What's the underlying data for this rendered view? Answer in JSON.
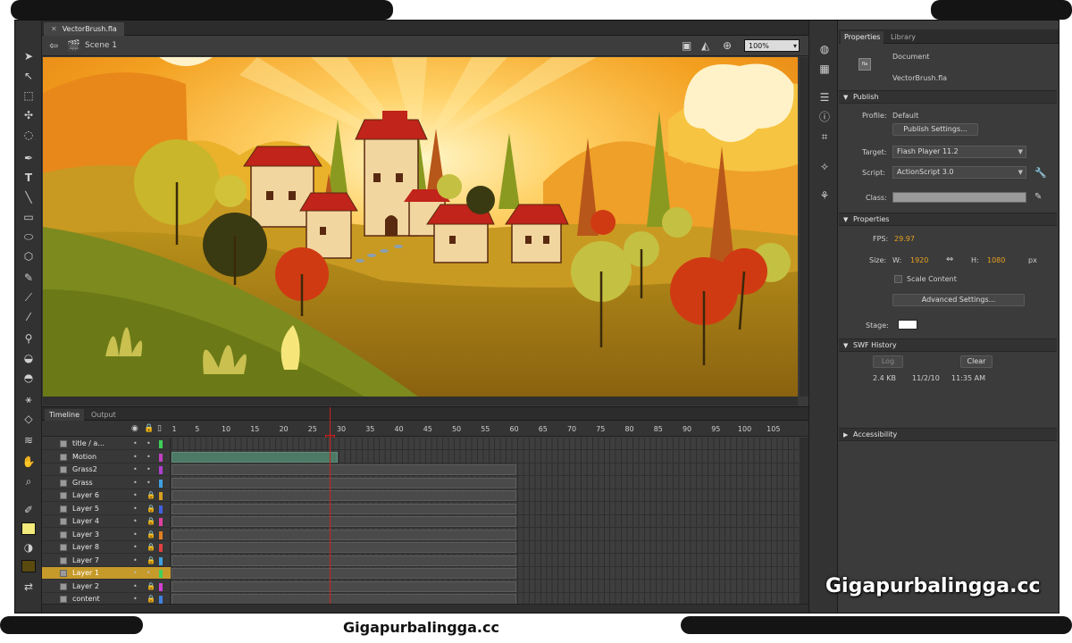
{
  "document": {
    "tab_title": "VectorBrush.fla",
    "scene_label": "Scene 1",
    "zoom": "100%"
  },
  "timeline": {
    "tabs": [
      "Timeline",
      "Output"
    ],
    "frame_labels": [
      "1",
      "5",
      "10",
      "15",
      "20",
      "25",
      "30",
      "35",
      "40",
      "45",
      "50",
      "55",
      "60",
      "65",
      "70",
      "75",
      "80",
      "85",
      "90",
      "95",
      "100",
      "105"
    ],
    "current_frame": 28,
    "layers": [
      {
        "name": "title / a...",
        "type": "folder",
        "color": "#3fd05a"
      },
      {
        "name": "Motion",
        "color": "#c040c0"
      },
      {
        "name": "Grass2",
        "color": "#b040d0"
      },
      {
        "name": "Grass",
        "color": "#40a0e0"
      },
      {
        "name": "Layer 6",
        "color": "#d8a020",
        "locked": true
      },
      {
        "name": "Layer 5",
        "color": "#4060e0",
        "locked": true
      },
      {
        "name": "Layer 4",
        "color": "#e040a0",
        "locked": true
      },
      {
        "name": "Layer 3",
        "color": "#e08020",
        "locked": true
      },
      {
        "name": "Layer 8",
        "color": "#e04040",
        "locked": true
      },
      {
        "name": "Layer 7",
        "color": "#40a0e0",
        "locked": true
      },
      {
        "name": "Layer 1",
        "color": "#3fd05a",
        "selected": true
      },
      {
        "name": "Layer 2",
        "color": "#d040d0",
        "locked": true
      },
      {
        "name": "content",
        "color": "#4080e0",
        "locked": true
      }
    ]
  },
  "properties": {
    "tabs": [
      "Properties",
      "Library"
    ],
    "doc_type": "Document",
    "doc_name": "VectorBrush.fla",
    "publish": {
      "section": "Publish",
      "profile_label": "Profile:",
      "profile_value": "Default",
      "publish_settings_button": "Publish Settings...",
      "target_label": "Target:",
      "target_value": "Flash Player 11.2",
      "script_label": "Script:",
      "script_value": "ActionScript 3.0",
      "class_label": "Class:"
    },
    "props": {
      "section": "Properties",
      "fps_label": "FPS:",
      "fps_value": "29.97",
      "size_label": "Size:",
      "w_label": "W:",
      "w_value": "1920",
      "h_label": "H:",
      "h_value": "1080",
      "unit": "px",
      "scale_content": "Scale Content",
      "advanced_button": "Advanced Settings...",
      "stage_label": "Stage:",
      "stage_color": "#ffffff"
    },
    "swf_history": {
      "section": "SWF History",
      "log_button": "Log",
      "clear_button": "Clear",
      "size": "2.4 KB",
      "date": "11/2/10",
      "time": "11:35 AM"
    },
    "accessibility": {
      "section": "Accessibility"
    }
  },
  "watermark": {
    "right": "Gigapurbalingga.cc",
    "bottom": "Gigapurbalingga.cc"
  }
}
